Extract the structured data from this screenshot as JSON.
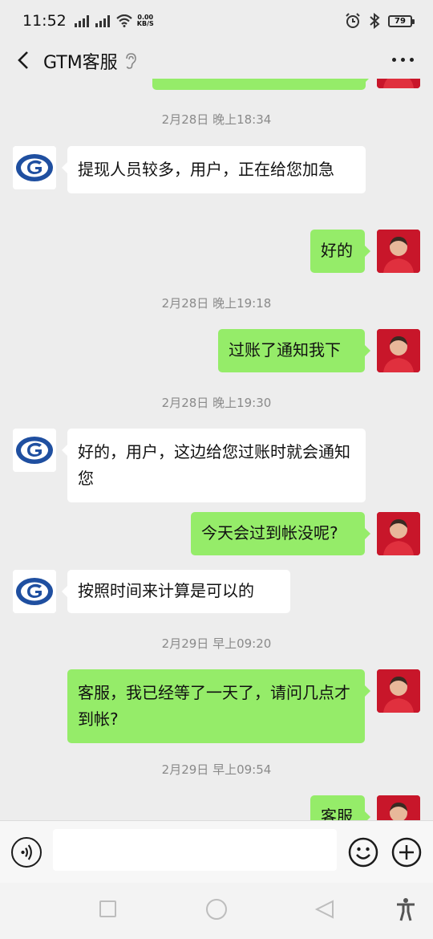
{
  "status_bar": {
    "time": "11:52",
    "net_speed_value": "0.00",
    "net_speed_unit": "KB/S",
    "battery": "79"
  },
  "header": {
    "title": "GTM客服"
  },
  "messages": [
    {
      "id": "m0",
      "side": "right",
      "text": ""
    },
    {
      "id": "t1",
      "type": "timestamp",
      "text": "2月28日 晚上18:34"
    },
    {
      "id": "m1",
      "side": "left",
      "text": "提现人员较多，用户，正在给您加急"
    },
    {
      "id": "m2",
      "side": "right",
      "text": "好的"
    },
    {
      "id": "t2",
      "type": "timestamp",
      "text": "2月28日 晚上19:18"
    },
    {
      "id": "m3",
      "side": "right",
      "text": "过账了通知我下"
    },
    {
      "id": "t3",
      "type": "timestamp",
      "text": "2月28日 晚上19:30"
    },
    {
      "id": "m4",
      "side": "left",
      "text": "好的，用户，这边给您过账时就会通知您"
    },
    {
      "id": "m5",
      "side": "right",
      "text": "今天会过到帐没呢?"
    },
    {
      "id": "m6",
      "side": "left",
      "text": "按照时间来计算是可以的"
    },
    {
      "id": "t4",
      "type": "timestamp",
      "text": "2月29日 早上09:20"
    },
    {
      "id": "m7",
      "side": "right",
      "text": "客服，我已经等了一天了，请问几点才到帐?"
    },
    {
      "id": "t5",
      "type": "timestamp",
      "text": "2月29日 早上09:54"
    },
    {
      "id": "m8",
      "side": "right",
      "text": "客服"
    }
  ],
  "input": {
    "placeholder": ""
  },
  "colors": {
    "background": "#ededed",
    "bubble_self": "#95ec69",
    "bubble_other": "#ffffff",
    "timestamp": "#8a8a8a",
    "avatar_logo": "#1f4fa0"
  },
  "icons": {
    "back": "chevron-left-icon",
    "ear": "ear-icon",
    "more": "more-dots-icon",
    "voice": "voice-icon",
    "emoji": "emoji-icon",
    "plus": "plus-icon"
  }
}
